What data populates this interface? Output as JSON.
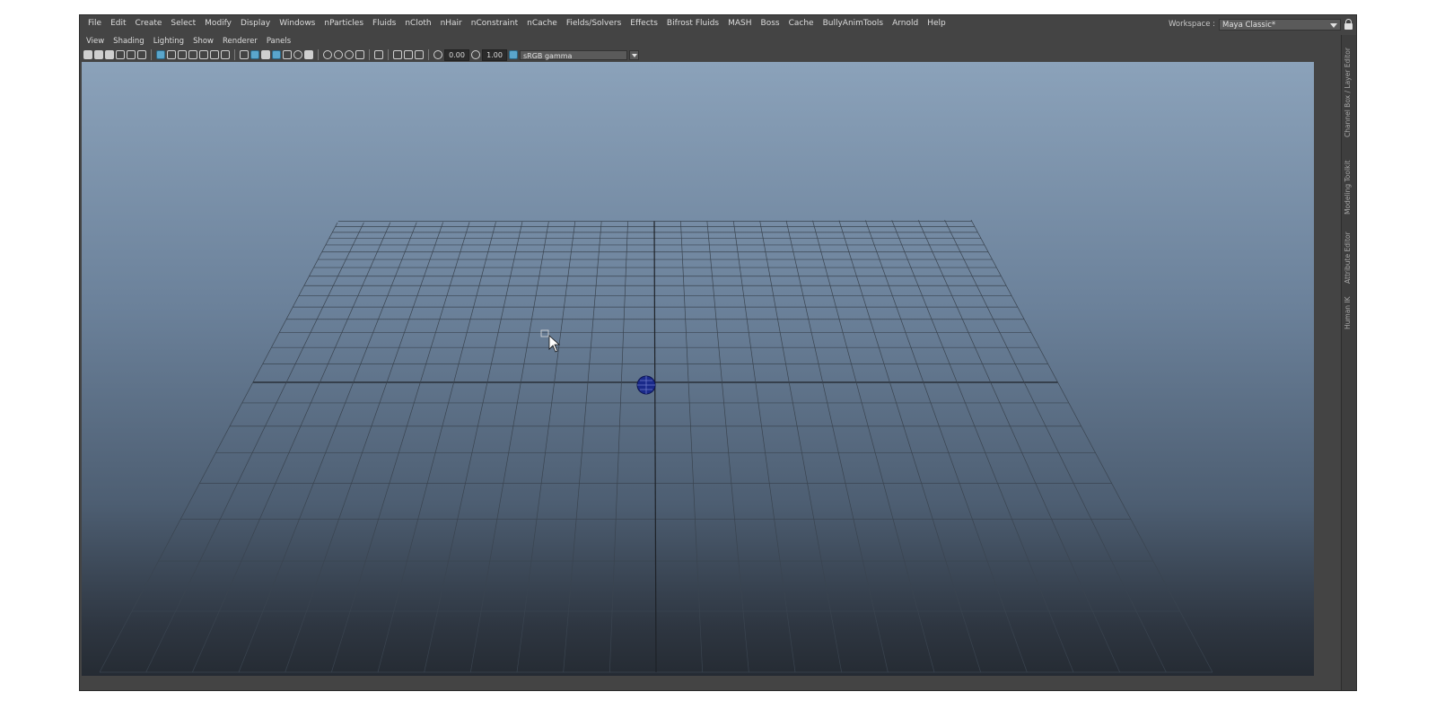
{
  "menubar": {
    "items": [
      "File",
      "Edit",
      "Create",
      "Select",
      "Modify",
      "Display",
      "Windows",
      "nParticles",
      "Fluids",
      "nCloth",
      "nHair",
      "nConstraint",
      "nCache",
      "Fields/Solvers",
      "Effects",
      "Bifrost Fluids",
      "MASH",
      "Boss",
      "Cache",
      "BullyAnimTools",
      "Arnold",
      "Help"
    ]
  },
  "workspace": {
    "label": "Workspace :",
    "value": "Maya Classic*"
  },
  "panel_menu": {
    "items": [
      "View",
      "Shading",
      "Lighting",
      "Show",
      "Renderer",
      "Panels"
    ]
  },
  "toolbar": {
    "exposure": "0.00",
    "gamma": "1.00",
    "color_space": "sRGB gamma"
  },
  "side_tabs": [
    "Channel Box / Layer Editor",
    "Modeling Toolkit",
    "Attribute Editor",
    "Human IK"
  ],
  "colors": {
    "background": "#444444",
    "viewport_top": "#8ba2ba",
    "viewport_bottom": "#252b33",
    "grid_line": "#3a4450",
    "grid_axis": "#1e2228",
    "accent": "#5aa6cc",
    "manipulator": "#1a2a8a"
  },
  "icons": [
    "camera-icon",
    "grid-icon",
    "wireframe-icon",
    "smooth-shade-icon",
    "lighting-icon",
    "isolate-icon",
    "colorspace-icon",
    "lock-icon",
    "cursor-icon",
    "pivot-manipulator-icon"
  ]
}
